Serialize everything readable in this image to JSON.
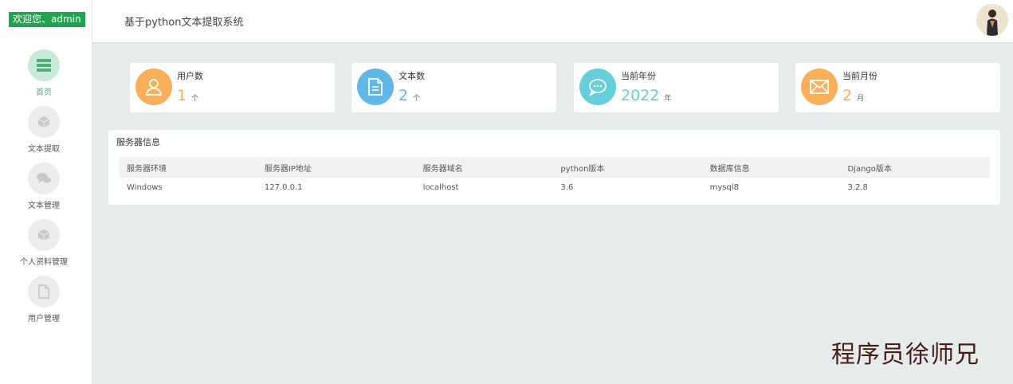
{
  "sidebar": {
    "welcome": "欢迎您、admin",
    "items": [
      {
        "label": "首页",
        "icon": "dashboard-icon",
        "active": true
      },
      {
        "label": "文本提取",
        "icon": "box-icon",
        "active": false
      },
      {
        "label": "文本管理",
        "icon": "chat-icon",
        "active": false
      },
      {
        "label": "个人资料管理",
        "icon": "box-icon",
        "active": false
      },
      {
        "label": "用户管理",
        "icon": "document-icon",
        "active": false
      }
    ]
  },
  "header": {
    "title": "基于python文本提取系统",
    "avatar_icon": "user-avatar"
  },
  "stats": [
    {
      "title": "用户数",
      "value": "1",
      "unit": "个",
      "color": "#f9ae5a",
      "icon": "user-icon"
    },
    {
      "title": "文本数",
      "value": "2",
      "unit": "个",
      "color": "#5fb8e8",
      "icon": "document-icon"
    },
    {
      "title": "当前年份",
      "value": "2022",
      "unit": "年",
      "color": "#66cfdc",
      "icon": "chat-bubble-icon"
    },
    {
      "title": "当前月份",
      "value": "2",
      "unit": "月",
      "color": "#f9ae5a",
      "icon": "mail-icon"
    }
  ],
  "server": {
    "title": "服务器信息",
    "headers": [
      "服务器环境",
      "服务器IP地址",
      "服务器域名",
      "python版本",
      "数据库信息",
      "Django版本"
    ],
    "row": [
      "Windows",
      "127.0.0.1",
      "localhost",
      "3.6",
      "mysql8",
      "3.2.8"
    ]
  },
  "watermark": "程序员徐师兄",
  "colors": {
    "accent_green": "#21a350",
    "background": "#e6ecec"
  }
}
